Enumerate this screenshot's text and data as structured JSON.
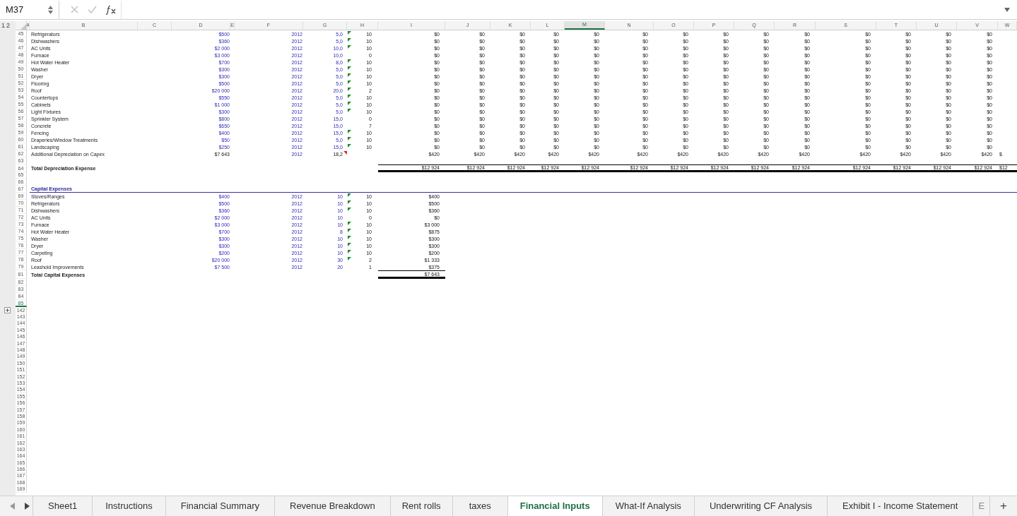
{
  "name_box": "M37",
  "outline_levels": [
    "1",
    "2"
  ],
  "columns": [
    {
      "label": "A",
      "selected": false
    },
    {
      "label": "B",
      "selected": false
    },
    {
      "label": "C",
      "selected": false
    },
    {
      "label": "D",
      "selected": false
    },
    {
      "label": "E",
      "selected": false
    },
    {
      "label": "F",
      "selected": false
    },
    {
      "label": "G",
      "selected": false
    },
    {
      "label": "H",
      "selected": false
    },
    {
      "label": "I",
      "selected": false
    },
    {
      "label": "J",
      "selected": false
    },
    {
      "label": "K",
      "selected": false
    },
    {
      "label": "L",
      "selected": false
    },
    {
      "label": "M",
      "selected": true
    },
    {
      "label": "N",
      "selected": false
    },
    {
      "label": "O",
      "selected": false
    },
    {
      "label": "P",
      "selected": false
    },
    {
      "label": "Q",
      "selected": false
    },
    {
      "label": "R",
      "selected": false
    },
    {
      "label": "S",
      "selected": false
    },
    {
      "label": "T",
      "selected": false
    },
    {
      "label": "U",
      "selected": false
    },
    {
      "label": "V",
      "selected": false
    },
    {
      "label": "W",
      "selected": false
    }
  ],
  "rows": [
    {
      "number": "45",
      "selected": false,
      "kind": "asset",
      "label": "Refrigerators",
      "cost": "$500",
      "inputs": true,
      "year": "2012",
      "life": "5,0",
      "error_check": true,
      "comment": false,
      "remaining": "10",
      "values": [
        "$0",
        "$0",
        "$0",
        "$0",
        "$0",
        "$0",
        "$0",
        "$0",
        "$0",
        "$0",
        "$0",
        "$0",
        "$0",
        "$0"
      ]
    },
    {
      "number": "46",
      "selected": false,
      "kind": "asset",
      "label": "Dishwashers",
      "cost": "$360",
      "inputs": true,
      "year": "2012",
      "life": "5,0",
      "error_check": true,
      "comment": false,
      "remaining": "10",
      "values": [
        "$0",
        "$0",
        "$0",
        "$0",
        "$0",
        "$0",
        "$0",
        "$0",
        "$0",
        "$0",
        "$0",
        "$0",
        "$0",
        "$0"
      ]
    },
    {
      "number": "47",
      "selected": false,
      "kind": "asset",
      "label": "AC Units",
      "cost": "$2 000",
      "inputs": true,
      "year": "2012",
      "life": "10,0",
      "error_check": true,
      "comment": false,
      "remaining": "10",
      "values": [
        "$0",
        "$0",
        "$0",
        "$0",
        "$0",
        "$0",
        "$0",
        "$0",
        "$0",
        "$0",
        "$0",
        "$0",
        "$0",
        "$0"
      ]
    },
    {
      "number": "48",
      "selected": false,
      "kind": "asset",
      "label": "Furnace",
      "cost": "$3 000",
      "inputs": true,
      "year": "2012",
      "life": "10,0",
      "error_check": false,
      "comment": false,
      "remaining": "0",
      "values": [
        "$0",
        "$0",
        "$0",
        "$0",
        "$0",
        "$0",
        "$0",
        "$0",
        "$0",
        "$0",
        "$0",
        "$0",
        "$0",
        "$0"
      ]
    },
    {
      "number": "49",
      "selected": false,
      "kind": "asset",
      "label": "Hot Water Heater",
      "cost": "$700",
      "inputs": true,
      "year": "2012",
      "life": "8,0",
      "error_check": true,
      "comment": false,
      "remaining": "10",
      "values": [
        "$0",
        "$0",
        "$0",
        "$0",
        "$0",
        "$0",
        "$0",
        "$0",
        "$0",
        "$0",
        "$0",
        "$0",
        "$0",
        "$0"
      ]
    },
    {
      "number": "50",
      "selected": false,
      "kind": "asset",
      "label": "Washer",
      "cost": "$300",
      "inputs": true,
      "year": "2012",
      "life": "5,0",
      "error_check": true,
      "comment": false,
      "remaining": "10",
      "values": [
        "$0",
        "$0",
        "$0",
        "$0",
        "$0",
        "$0",
        "$0",
        "$0",
        "$0",
        "$0",
        "$0",
        "$0",
        "$0",
        "$0"
      ]
    },
    {
      "number": "51",
      "selected": false,
      "kind": "asset",
      "label": "Dryer",
      "cost": "$300",
      "inputs": true,
      "year": "2012",
      "life": "5,0",
      "error_check": true,
      "comment": false,
      "remaining": "10",
      "values": [
        "$0",
        "$0",
        "$0",
        "$0",
        "$0",
        "$0",
        "$0",
        "$0",
        "$0",
        "$0",
        "$0",
        "$0",
        "$0",
        "$0"
      ]
    },
    {
      "number": "52",
      "selected": false,
      "kind": "asset",
      "label": "Flooring",
      "cost": "$500",
      "inputs": true,
      "year": "2012",
      "life": "5,0",
      "error_check": true,
      "comment": false,
      "remaining": "10",
      "values": [
        "$0",
        "$0",
        "$0",
        "$0",
        "$0",
        "$0",
        "$0",
        "$0",
        "$0",
        "$0",
        "$0",
        "$0",
        "$0",
        "$0"
      ]
    },
    {
      "number": "53",
      "selected": false,
      "kind": "asset",
      "label": "Roof",
      "cost": "$20 000",
      "inputs": true,
      "year": "2012",
      "life": "20,0",
      "error_check": true,
      "comment": false,
      "remaining": "2",
      "values": [
        "$0",
        "$0",
        "$0",
        "$0",
        "$0",
        "$0",
        "$0",
        "$0",
        "$0",
        "$0",
        "$0",
        "$0",
        "$0",
        "$0"
      ]
    },
    {
      "number": "54",
      "selected": false,
      "kind": "asset",
      "label": "Countertops",
      "cost": "$550",
      "inputs": true,
      "year": "2012",
      "life": "5,0",
      "error_check": true,
      "comment": false,
      "remaining": "10",
      "values": [
        "$0",
        "$0",
        "$0",
        "$0",
        "$0",
        "$0",
        "$0",
        "$0",
        "$0",
        "$0",
        "$0",
        "$0",
        "$0",
        "$0"
      ]
    },
    {
      "number": "55",
      "selected": false,
      "kind": "asset",
      "label": "Cabinets",
      "cost": "$1 000",
      "inputs": true,
      "year": "2012",
      "life": "5,0",
      "error_check": true,
      "comment": false,
      "remaining": "10",
      "values": [
        "$0",
        "$0",
        "$0",
        "$0",
        "$0",
        "$0",
        "$0",
        "$0",
        "$0",
        "$0",
        "$0",
        "$0",
        "$0",
        "$0"
      ]
    },
    {
      "number": "56",
      "selected": false,
      "kind": "asset",
      "label": "Light Fixtures",
      "cost": "$300",
      "inputs": true,
      "year": "2012",
      "life": "5,0",
      "error_check": true,
      "comment": false,
      "remaining": "10",
      "values": [
        "$0",
        "$0",
        "$0",
        "$0",
        "$0",
        "$0",
        "$0",
        "$0",
        "$0",
        "$0",
        "$0",
        "$0",
        "$0",
        "$0"
      ]
    },
    {
      "number": "57",
      "selected": false,
      "kind": "asset",
      "label": "Sprinkler System",
      "cost": "$800",
      "inputs": true,
      "year": "2012",
      "life": "15,0",
      "error_check": false,
      "comment": false,
      "remaining": "0",
      "values": [
        "$0",
        "$0",
        "$0",
        "$0",
        "$0",
        "$0",
        "$0",
        "$0",
        "$0",
        "$0",
        "$0",
        "$0",
        "$0",
        "$0"
      ]
    },
    {
      "number": "58",
      "selected": false,
      "kind": "asset",
      "label": "Concrete",
      "cost": "$650",
      "inputs": true,
      "year": "2012",
      "life": "15,0",
      "error_check": false,
      "comment": false,
      "remaining": "7",
      "values": [
        "$0",
        "$0",
        "$0",
        "$0",
        "$0",
        "$0",
        "$0",
        "$0",
        "$0",
        "$0",
        "$0",
        "$0",
        "$0",
        "$0"
      ]
    },
    {
      "number": "59",
      "selected": false,
      "kind": "asset",
      "label": "Fencing",
      "cost": "$400",
      "inputs": true,
      "year": "2012",
      "life": "15,0",
      "error_check": true,
      "comment": false,
      "remaining": "10",
      "values": [
        "$0",
        "$0",
        "$0",
        "$0",
        "$0",
        "$0",
        "$0",
        "$0",
        "$0",
        "$0",
        "$0",
        "$0",
        "$0",
        "$0"
      ]
    },
    {
      "number": "60",
      "selected": false,
      "kind": "asset",
      "label": "Draperies/Window Treatments",
      "cost": "$50",
      "inputs": true,
      "year": "2012",
      "life": "5,0",
      "error_check": true,
      "comment": false,
      "remaining": "10",
      "values": [
        "$0",
        "$0",
        "$0",
        "$0",
        "$0",
        "$0",
        "$0",
        "$0",
        "$0",
        "$0",
        "$0",
        "$0",
        "$0",
        "$0"
      ]
    },
    {
      "number": "61",
      "selected": false,
      "kind": "asset",
      "label": "Landscaping",
      "cost": "$250",
      "inputs": true,
      "year": "2012",
      "life": "15,0",
      "error_check": true,
      "comment": false,
      "remaining": "10",
      "values": [
        "$0",
        "$0",
        "$0",
        "$0",
        "$0",
        "$0",
        "$0",
        "$0",
        "$0",
        "$0",
        "$0",
        "$0",
        "$0",
        "$0"
      ]
    },
    {
      "number": "62",
      "selected": false,
      "kind": "asset",
      "label": "Additional Depreciation on Capex",
      "cost": "$7 643",
      "inputs": false,
      "year": "2012",
      "life": "18,2",
      "error_check": false,
      "comment": true,
      "values": [
        "$420",
        "$420",
        "$420",
        "$420",
        "$420",
        "$420",
        "$420",
        "$420",
        "$420",
        "$420",
        "$420",
        "$420",
        "$420",
        "$420",
        "$"
      ]
    },
    {
      "number": "63",
      "selected": false,
      "kind": "blank"
    },
    {
      "number": "64",
      "selected": false,
      "kind": "total",
      "label": "Total Depreciation Expense",
      "values": [
        "$12 924",
        "$12 924",
        "$12 924",
        "$12 924",
        "$12 924",
        "$12 924",
        "$12 924",
        "$12 924",
        "$12 924",
        "$12 924",
        "$12 924",
        "$12 924",
        "$12 924",
        "$12 924",
        "$12"
      ]
    },
    {
      "number": "65",
      "selected": false,
      "kind": "blank"
    },
    {
      "number": "66",
      "selected": false,
      "kind": "blank"
    },
    {
      "number": "67",
      "selected": false,
      "kind": "section",
      "label": "Capital Expenses"
    },
    {
      "number": "69",
      "selected": false,
      "kind": "asset",
      "label": "Stoves/Ranges",
      "cost": "$400",
      "inputs": true,
      "year": "2012",
      "life": "10",
      "error_check": true,
      "comment": false,
      "remaining": "10",
      "values": [
        "$400"
      ]
    },
    {
      "number": "70",
      "selected": false,
      "kind": "asset",
      "label": "Refrigerators",
      "cost": "$500",
      "inputs": true,
      "year": "2012",
      "life": "10",
      "error_check": true,
      "comment": false,
      "remaining": "10",
      "values": [
        "$500"
      ]
    },
    {
      "number": "71",
      "selected": false,
      "kind": "asset",
      "label": "Dishwashers",
      "cost": "$360",
      "inputs": true,
      "year": "2012",
      "life": "10",
      "error_check": true,
      "comment": false,
      "remaining": "10",
      "values": [
        "$360"
      ]
    },
    {
      "number": "72",
      "selected": false,
      "kind": "asset",
      "label": "AC Units",
      "cost": "$2 000",
      "inputs": true,
      "year": "2012",
      "life": "10",
      "error_check": false,
      "comment": false,
      "remaining": "0",
      "values": [
        "$0"
      ]
    },
    {
      "number": "73",
      "selected": false,
      "kind": "asset",
      "label": "Furnace",
      "cost": "$3 000",
      "inputs": true,
      "year": "2012",
      "life": "10",
      "error_check": true,
      "comment": false,
      "remaining": "10",
      "values": [
        "$3 000"
      ]
    },
    {
      "number": "74",
      "selected": false,
      "kind": "asset",
      "label": "Hot Water Heater",
      "cost": "$700",
      "inputs": true,
      "year": "2012",
      "life": "8",
      "error_check": true,
      "comment": false,
      "remaining": "10",
      "values": [
        "$875"
      ]
    },
    {
      "number": "75",
      "selected": false,
      "kind": "asset",
      "label": "Washer",
      "cost": "$300",
      "inputs": true,
      "year": "2012",
      "life": "10",
      "error_check": true,
      "comment": false,
      "remaining": "10",
      "values": [
        "$300"
      ]
    },
    {
      "number": "76",
      "selected": false,
      "kind": "asset",
      "label": "Dryer",
      "cost": "$300",
      "inputs": true,
      "year": "2012",
      "life": "10",
      "error_check": true,
      "comment": false,
      "remaining": "10",
      "values": [
        "$300"
      ]
    },
    {
      "number": "77",
      "selected": false,
      "kind": "asset",
      "label": "Carpeting",
      "cost": "$200",
      "inputs": true,
      "year": "2012",
      "life": "10",
      "error_check": true,
      "comment": false,
      "remaining": "10",
      "values": [
        "$200"
      ]
    },
    {
      "number": "78",
      "selected": false,
      "kind": "asset",
      "label": "Roof",
      "cost": "$20 000",
      "inputs": true,
      "year": "2012",
      "life": "30",
      "error_check": true,
      "comment": false,
      "remaining": "2",
      "values": [
        "$1 333"
      ]
    },
    {
      "number": "79",
      "selected": false,
      "kind": "asset",
      "label": "Leashold Improvements",
      "cost": "$7 500",
      "inputs": true,
      "year": "2012",
      "life": "20",
      "error_check": false,
      "comment": false,
      "remaining": "1",
      "values": [
        "$375"
      ]
    },
    {
      "number": "81",
      "selected": false,
      "kind": "total",
      "label": "Total Capital Expenses",
      "values": [
        "$7 643"
      ]
    },
    {
      "number": "82",
      "selected": false,
      "kind": "blank"
    },
    {
      "number": "83",
      "selected": false,
      "kind": "blank"
    },
    {
      "number": "84",
      "selected": false,
      "kind": "blank"
    },
    {
      "number": "85",
      "selected": true,
      "kind": "blank"
    }
  ],
  "collapsed_group": {
    "expanded": false
  },
  "rows_below": [
    {
      "number": "142",
      "selected": false
    },
    {
      "number": "143",
      "selected": false
    },
    {
      "number": "144",
      "selected": false
    },
    {
      "number": "145",
      "selected": false
    },
    {
      "number": "146",
      "selected": false
    },
    {
      "number": "147",
      "selected": false
    },
    {
      "number": "148",
      "selected": false
    },
    {
      "number": "149",
      "selected": false
    },
    {
      "number": "150",
      "selected": false
    },
    {
      "number": "151",
      "selected": false
    },
    {
      "number": "152",
      "selected": false
    },
    {
      "number": "153",
      "selected": false
    },
    {
      "number": "154",
      "selected": false
    },
    {
      "number": "155",
      "selected": false
    },
    {
      "number": "156",
      "selected": false
    },
    {
      "number": "157",
      "selected": false
    },
    {
      "number": "158",
      "selected": false
    },
    {
      "number": "159",
      "selected": false
    },
    {
      "number": "160",
      "selected": false
    },
    {
      "number": "161",
      "selected": false
    },
    {
      "number": "162",
      "selected": false
    },
    {
      "number": "163",
      "selected": false
    },
    {
      "number": "164",
      "selected": false
    },
    {
      "number": "165",
      "selected": false
    },
    {
      "number": "166",
      "selected": false
    },
    {
      "number": "167",
      "selected": false
    },
    {
      "number": "168",
      "selected": false
    },
    {
      "number": "169",
      "selected": false
    }
  ],
  "tabs": [
    {
      "label": "Sheet1",
      "selected": false,
      "faded": false
    },
    {
      "label": "Instructions",
      "selected": false,
      "faded": false
    },
    {
      "label": "Financial Summary",
      "selected": false,
      "faded": false
    },
    {
      "label": "Revenue Breakdown",
      "selected": false,
      "faded": false
    },
    {
      "label": "Rent rolls",
      "selected": false,
      "faded": false
    },
    {
      "label": "taxes",
      "selected": false,
      "faded": false
    },
    {
      "label": "Financial Inputs",
      "selected": true,
      "faded": false
    },
    {
      "label": "What-If Analysis",
      "selected": false,
      "faded": false
    },
    {
      "label": "Underwriting CF Analysis",
      "selected": false,
      "faded": false
    },
    {
      "label": "Exhibit I - Income Statement",
      "selected": false,
      "faded": false
    },
    {
      "label": "E",
      "selected": false,
      "faded": true
    }
  ],
  "add_sheet": "+"
}
